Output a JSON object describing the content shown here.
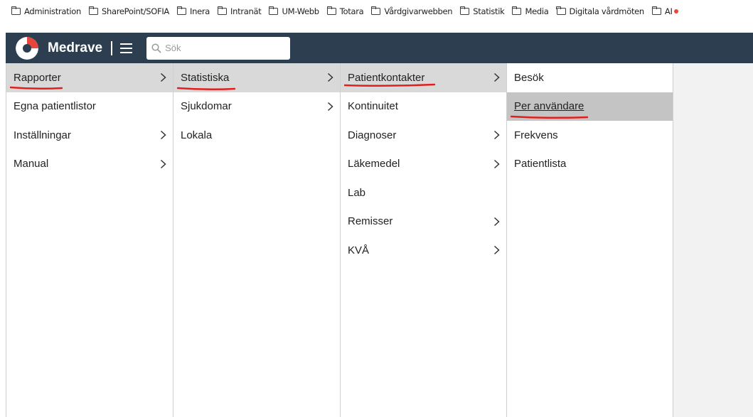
{
  "bookmarks": [
    "Administration",
    "SharePoint/SOFIA",
    "Inera",
    "Intranät",
    "UM-Webb",
    "Totara",
    "Vårdgivarwebben",
    "Statistik",
    "Media",
    "Digitala vårdmöten",
    "AI"
  ],
  "app": {
    "brand": "Medrave",
    "search_placeholder": "Sök"
  },
  "columns": {
    "col1": [
      {
        "label": "Rapporter",
        "has_submenu": true,
        "state": "active"
      },
      {
        "label": "Egna patientlistor",
        "has_submenu": false
      },
      {
        "label": "Inställningar",
        "has_submenu": true
      },
      {
        "label": "Manual",
        "has_submenu": true
      }
    ],
    "col2": [
      {
        "label": "Statistiska",
        "has_submenu": true,
        "state": "active"
      },
      {
        "label": "Sjukdomar",
        "has_submenu": true
      },
      {
        "label": "Lokala",
        "has_submenu": false
      }
    ],
    "col3": [
      {
        "label": "Patientkontakter",
        "has_submenu": true,
        "state": "active"
      },
      {
        "label": "Kontinuitet",
        "has_submenu": false
      },
      {
        "label": "Diagnoser",
        "has_submenu": true
      },
      {
        "label": "Läkemedel",
        "has_submenu": true
      },
      {
        "label": "Lab",
        "has_submenu": false
      },
      {
        "label": "Remisser",
        "has_submenu": true
      },
      {
        "label": "KVÅ",
        "has_submenu": true
      }
    ],
    "col4": [
      {
        "label": "Besök",
        "has_submenu": false
      },
      {
        "label": "Per användare",
        "has_submenu": false,
        "state": "hovered"
      },
      {
        "label": "Frekvens",
        "has_submenu": false
      },
      {
        "label": "Patientlista",
        "has_submenu": false
      }
    ]
  },
  "colors": {
    "appbar": "#2d3e50",
    "active_row": "#d9d9d9",
    "hover_row": "#c4c4c4",
    "annotation_red": "#e0201e",
    "logo_red": "#e8453c"
  }
}
